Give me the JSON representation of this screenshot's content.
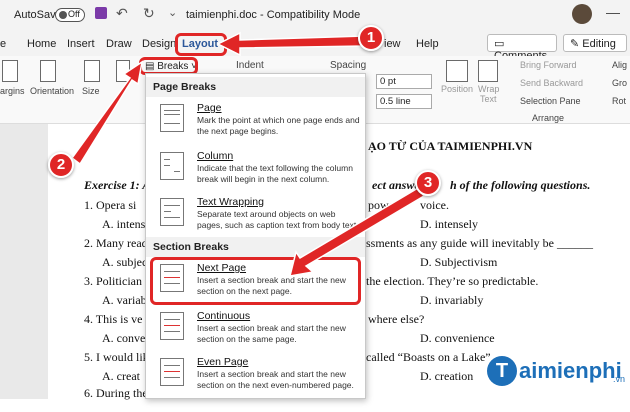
{
  "titlebar": {
    "autosave_label": "AutoSave",
    "autosave_state": "Off",
    "doc_title": "taimienphi.doc  -  Compatibility Mode"
  },
  "tabs": {
    "home": "Home",
    "insert": "Insert",
    "draw": "Draw",
    "design": "Design",
    "layout": "Layout",
    "review_partial": "Revi",
    "view_partial": "iew",
    "help": "Help",
    "comments_button": "Comments",
    "editing_button": "Editing"
  },
  "ribbon": {
    "margins": "argins",
    "orientation": "Orientation",
    "size": "Size",
    "breaks": "Breaks",
    "indent": "Indent",
    "spacing": "Spacing",
    "spacing_before": "0 pt",
    "spacing_line": "0.5 line",
    "position": "Position",
    "wrap_text_1": "Wrap",
    "wrap_text_2": "Text",
    "bring_forward": "Bring Forward",
    "send_backward": "Send Backward",
    "selection_pane": "Selection Pane",
    "arrange": "Arrange",
    "align_partial": "Alig",
    "group_partial": "Gro",
    "rotate_partial": "Rot"
  },
  "breaks_menu": {
    "page_breaks_header": "Page Breaks",
    "section_breaks_header": "Section Breaks",
    "items": [
      {
        "title": "Page",
        "desc": "Mark the point at which one page ends and the next page begins."
      },
      {
        "title": "Column",
        "desc": "Indicate that the text following the column break will begin in the next column."
      },
      {
        "title": "Text Wrapping",
        "desc": "Separate text around objects on web pages, such as caption text from body text."
      },
      {
        "title": "Next Page",
        "desc": "Insert a section break and start the new section on the next page."
      },
      {
        "title": "Continuous",
        "desc": "Insert a section break and start the new section on the same page."
      },
      {
        "title": "Even Page",
        "desc": "Insert a section break and start the new section on the next even-numbered page."
      }
    ]
  },
  "document": {
    "heading": "ẠO TỪ CỦA TAIMIENPHI.VN",
    "exercise_left": "Exercise 1: A",
    "exercise_right": "ect answer",
    "exercise_right2": "h of the following questions.",
    "lines": [
      {
        "left": "1.  Opera si",
        "right": "powe",
        "right2": "voice."
      },
      {
        "left": "A. intens",
        "right": "D. intensely"
      },
      {
        "left": "2. Many read",
        "right": "ssments as any guide will inevitably be ______"
      },
      {
        "left": "A. subjec",
        "right": "D. Subjectivism"
      },
      {
        "left": "3. Politician",
        "right": "the election. They’re so predictable."
      },
      {
        "left": "A. variab",
        "right": "D. invariably"
      },
      {
        "left": "4. This is ve",
        "right": "where else?"
      },
      {
        "left": "A. conve",
        "right": "D. convenience"
      },
      {
        "left": "5. I would lik",
        "right": "called “Boasts on a Lake”"
      },
      {
        "left": "A. creat",
        "right": "D. creation"
      },
      {
        "left": "6. During the",
        "right": ""
      }
    ]
  },
  "callouts": [
    "1",
    "2",
    "3"
  ],
  "watermark": {
    "brand": "aimienphi",
    "suffix": ".vn",
    "initial": "T"
  },
  "colors": {
    "accent_red": "#e02626",
    "word_blue": "#2b579a",
    "brand_blue": "#1d6fb8"
  }
}
